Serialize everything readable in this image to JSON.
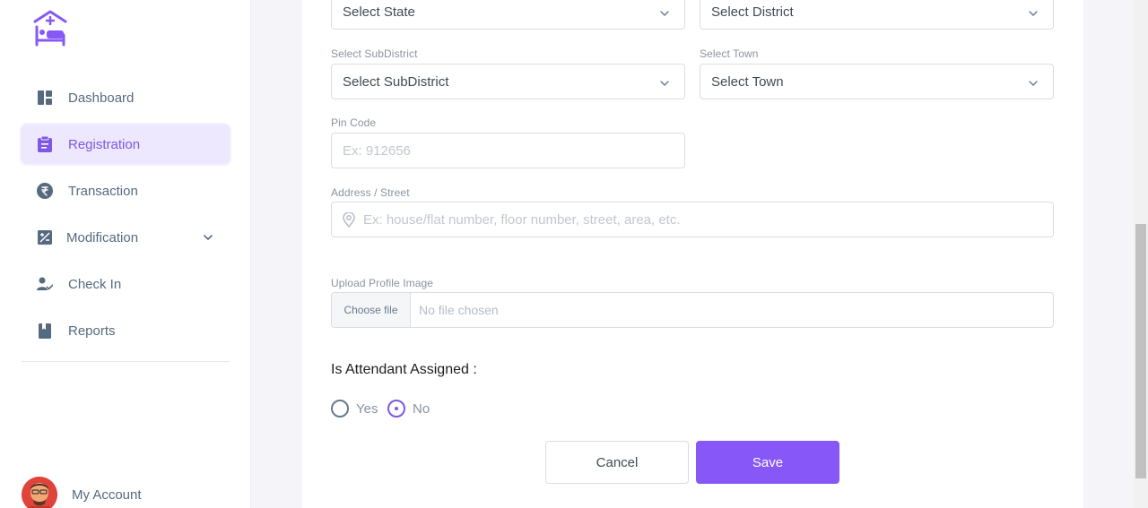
{
  "sidebar": {
    "items": [
      {
        "label": "Dashboard",
        "icon": "dashboard-icon"
      },
      {
        "label": "Registration",
        "icon": "clipboard-icon"
      },
      {
        "label": "Transaction",
        "icon": "rupee-icon"
      },
      {
        "label": "Modification",
        "icon": "modification-icon"
      },
      {
        "label": "Check In",
        "icon": "user-check-icon"
      },
      {
        "label": "Reports",
        "icon": "book-icon"
      }
    ],
    "account_label": "My Account"
  },
  "form": {
    "state_select": "Select State",
    "district_select": "Select District",
    "subdistrict_label": "Select SubDistrict",
    "subdistrict_select": "Select SubDistrict",
    "town_label": "Select Town",
    "town_select": "Select Town",
    "pincode_label": "Pin Code",
    "pincode_placeholder": "Ex: 912656",
    "address_label": "Address / Street",
    "address_placeholder": "Ex: house/flat number, floor number, street, area, etc.",
    "upload_label": "Upload Profile Image",
    "choose_file": "Choose file",
    "no_file": "No file chosen",
    "attendant_title": "Is Attendant Assigned :",
    "radio_yes": "Yes",
    "radio_no": "No",
    "cancel": "Cancel",
    "save": "Save"
  },
  "colors": {
    "accent": "#8758f7",
    "active_bg": "#ede8fd"
  }
}
